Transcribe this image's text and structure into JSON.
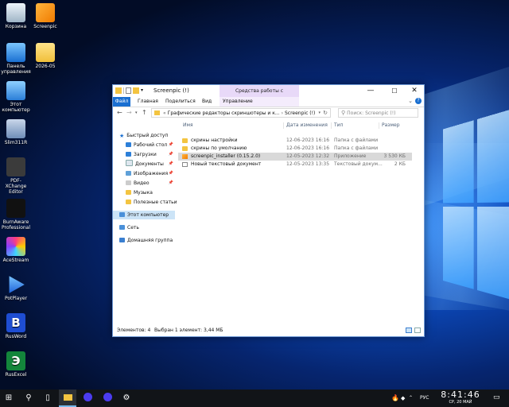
{
  "desktop": {
    "icons": [
      {
        "label": "Корзина"
      },
      {
        "label": "Screenpic"
      },
      {
        "label": "Панель управления"
      },
      {
        "label": "2026-05"
      },
      {
        "label": "Этот компьютер"
      },
      {
        "label": "Slim311R"
      },
      {
        "label": "PDF-XChange Editor"
      },
      {
        "label": "BurnAware Professional"
      },
      {
        "label": "AceStream"
      },
      {
        "label": "PotPlayer"
      },
      {
        "label": "RusWord",
        "glyph": "В"
      },
      {
        "label": "RusExcel",
        "glyph": "Э"
      }
    ]
  },
  "explorer": {
    "title": "Screenpic (!)",
    "context_title": "Средства работы с приложениями",
    "controls": {
      "minimize": "—",
      "maximize": "☐",
      "close": "✕"
    },
    "ribbon": {
      "file": "Файл",
      "home": "Главная",
      "share": "Поделиться",
      "view": "Вид",
      "manage": "Управление",
      "help_glyph": "?"
    },
    "address": {
      "path": [
        "Графические редакторы скриншотеры и к...",
        "Screenpic (!)"
      ],
      "search_placeholder": "Поиск: Screenpic (!)"
    },
    "nav_pane": {
      "quick_access": "Быстрый доступ",
      "items": [
        {
          "label": "Рабочий стол",
          "pinned": true
        },
        {
          "label": "Загрузки",
          "pinned": true
        },
        {
          "label": "Документы",
          "pinned": true
        },
        {
          "label": "Изображения",
          "pinned": true
        },
        {
          "label": "Видео",
          "pinned": true
        },
        {
          "label": "Музыка",
          "pinned": false
        },
        {
          "label": "Полезные статьи",
          "pinned": false
        }
      ],
      "this_pc": "Этот компьютер",
      "network": "Сеть",
      "homegroup": "Домашняя группа"
    },
    "columns": {
      "name": "Имя",
      "date": "Дата изменения",
      "type": "Тип",
      "size": "Размер"
    },
    "files": [
      {
        "name": "скрины настройки",
        "date": "12-06-2023 16:16",
        "type": "Папка с файлами",
        "size": "",
        "kind": "folder"
      },
      {
        "name": "скрины по умолчанию",
        "date": "12-06-2023 16:16",
        "type": "Папка с файлами",
        "size": "",
        "kind": "folder"
      },
      {
        "name": "screenpic_installer (0.15.2.0)",
        "date": "12-05-2023 12:32",
        "type": "Приложение",
        "size": "3 530 КБ",
        "kind": "app",
        "selected": true
      },
      {
        "name": "Новый текстовый документ",
        "date": "12-05-2023 13:35",
        "type": "Текстовый докум...",
        "size": "2 КБ",
        "kind": "txt"
      }
    ],
    "status": {
      "count": "Элементов: 4",
      "selection": "Выбран 1 элемент: 3,44 МБ"
    }
  },
  "taskbar": {
    "language": "РУС",
    "time": "8:41:46",
    "date": "СР, 20 МАЙ"
  }
}
